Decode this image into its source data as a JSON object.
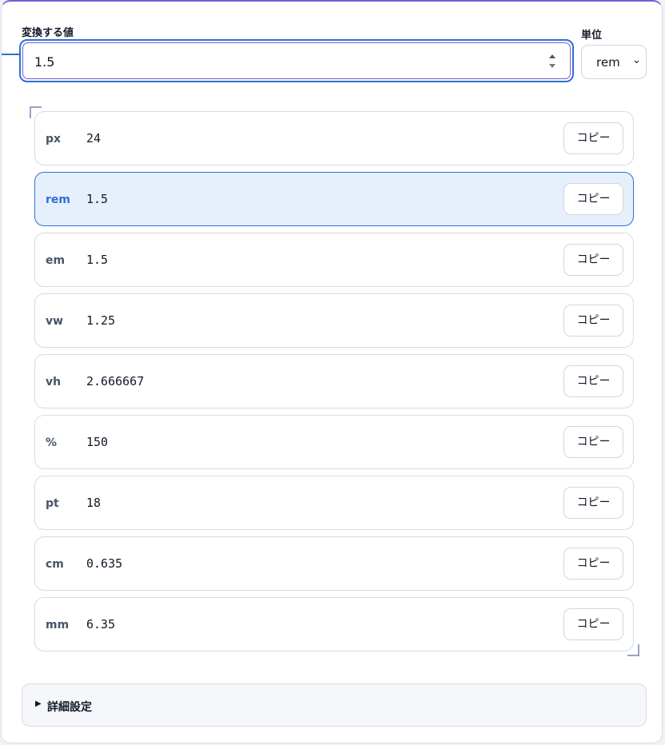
{
  "form": {
    "value_label": "変換する値",
    "value": "1.5",
    "unit_label": "単位",
    "unit_selected": "rem"
  },
  "results": [
    {
      "unit": "px",
      "value": "24",
      "copy_label": "コピー"
    },
    {
      "unit": "rem",
      "value": "1.5",
      "copy_label": "コピー",
      "active": true
    },
    {
      "unit": "em",
      "value": "1.5",
      "copy_label": "コピー"
    },
    {
      "unit": "vw",
      "value": "1.25",
      "copy_label": "コピー"
    },
    {
      "unit": "vh",
      "value": "2.666667",
      "copy_label": "コピー"
    },
    {
      "unit": "%",
      "value": "150",
      "copy_label": "コピー"
    },
    {
      "unit": "pt",
      "value": "18",
      "copy_label": "コピー"
    },
    {
      "unit": "cm",
      "value": "0.635",
      "copy_label": "コピー"
    },
    {
      "unit": "mm",
      "value": "6.35",
      "copy_label": "コピー"
    }
  ],
  "details": {
    "label": "詳細設定"
  },
  "colors": {
    "accent": "#2f6fd3",
    "active_row_bg": "#e6effc",
    "card_border_top": "#6b5fd6"
  }
}
